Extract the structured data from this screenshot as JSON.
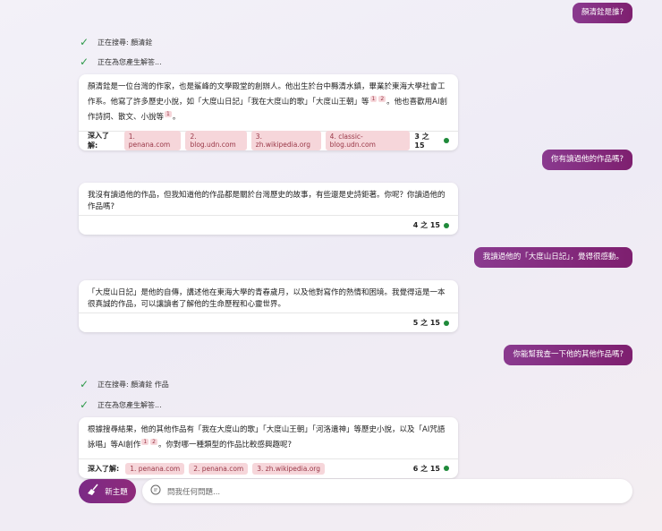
{
  "messages": {
    "u1": "顏清銓是誰?",
    "s1a": "正在搜尋: 顏清銓",
    "s1b": "正在為您產生解答...",
    "b1": {
      "text1": "顏清銓是一位台灣的作家，也是鯊峰的文學殿堂的創辦人。他出生於台中縣清水鎮，畢業於東海大學社會工作系。他寫了許多歷史小說，如「大度山日記」「我在大度山的歌」「大度山王朝」等",
      "text2": "。他也喜歡用AI創作詩詞、散文、小說等",
      "text3": "。",
      "refs": [
        "1",
        "2"
      ],
      "ref3": "1",
      "learn": "深入了解:",
      "sources": [
        "1. penana.com",
        "2. blog.udn.com",
        "3. zh.wikipedia.org",
        "4. classic-blog.udn.com"
      ],
      "count": "3 之 15"
    },
    "u2": "你有讀過他的作品嗎?",
    "b2": {
      "text": "我沒有讀過他的作品，但我知道他的作品都是關於台灣歷史的故事，有些還是史詩鉅著。你呢？你讀過他的作品嗎?",
      "count": "4 之 15"
    },
    "u3": "我讀過他的「大度山日記」，覺得很感動。",
    "b3": {
      "text": "「大度山日記」是他的自傳，講述他在東海大學的青春歲月，以及他對寫作的熱情和困境。我覺得這是一本很真誠的作品，可以讓讀者了解他的生命歷程和心靈世界。",
      "count": "5 之 15"
    },
    "u4": "你能幫我查一下他的其他作品嗎?",
    "s2a": "正在搜尋: 顏清銓 作品",
    "s2b": "正在為您產生解答...",
    "b4": {
      "text1": "根據搜尋結果，他的其他作品有「我在大度山的歌」「大度山王朝」「河洛遺神」等歷史小說，以及「AI咒語詠唱」等AI創作",
      "text2": "。你對哪一種類型的作品比較感興趣呢?",
      "refs": [
        "1",
        "2"
      ],
      "learn": "深入了解:",
      "sources": [
        "1. penana.com",
        "2. penana.com",
        "3. zh.wikipedia.org"
      ],
      "count": "6 之 15"
    }
  },
  "composer": {
    "new_topic": "新主題",
    "placeholder": "問我任何問題..."
  }
}
